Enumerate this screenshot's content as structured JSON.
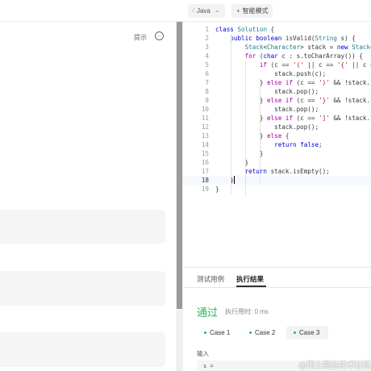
{
  "toolbar": {
    "language": "Java",
    "mode_label": "智能模式"
  },
  "left_panel": {
    "hint_label": "提示"
  },
  "editor": {
    "lines": [
      {
        "n": "1",
        "text": "class Solution {"
      },
      {
        "n": "2",
        "text": "    public boolean isValid(String s) {"
      },
      {
        "n": "3",
        "text": "        Stack<Character> stack = new Stack<>();"
      },
      {
        "n": "4",
        "text": "        for (char c : s.toCharArray()) {"
      },
      {
        "n": "5",
        "text": "            if (c == '(' || c == '{' || c == '[') {"
      },
      {
        "n": "6",
        "text": "                stack.push(c);"
      },
      {
        "n": "7",
        "text": "            } else if (c == ')' && !stack.isEmpty()"
      },
      {
        "n": "8",
        "text": "                stack.pop();"
      },
      {
        "n": "9",
        "text": "            } else if (c == '}' && !stack.isEmpty()"
      },
      {
        "n": "10",
        "text": "                stack.pop();"
      },
      {
        "n": "11",
        "text": "            } else if (c == ']' && !stack.isEmpty()"
      },
      {
        "n": "12",
        "text": "                stack.pop();"
      },
      {
        "n": "13",
        "text": "            } else {"
      },
      {
        "n": "14",
        "text": "                return false;"
      },
      {
        "n": "15",
        "text": "            }"
      },
      {
        "n": "16",
        "text": "        }"
      },
      {
        "n": "17",
        "text": "        return stack.isEmpty();"
      },
      {
        "n": "18",
        "text": "    }"
      },
      {
        "n": "19",
        "text": "}"
      }
    ],
    "active_line": "18"
  },
  "result_panel": {
    "tabs": [
      "测试用例",
      "执行结果"
    ],
    "active_tab": "执行结果",
    "status": "通过",
    "runtime": "执行用时: 0 ms",
    "cases": [
      "Case 1",
      "Case 2",
      "Case 3"
    ],
    "active_case": "Case 3",
    "input_label": "输入",
    "input_value": "s ="
  },
  "watermark": "@稀土掘金技术社区",
  "colors": {
    "success": "#2db55d",
    "keyword": "#0000d0",
    "control_keyword": "#a000a0",
    "type": "#1d7f8a",
    "string": "#a31515"
  },
  "icons": {
    "more": "more-icon",
    "chevron": "chevron-down-icon",
    "mode": "plus-icon"
  }
}
